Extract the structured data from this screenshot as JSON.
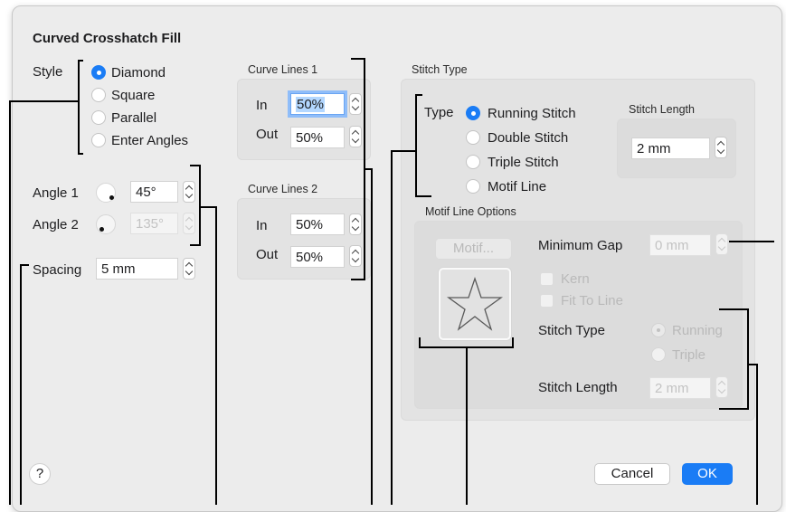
{
  "dialog": {
    "title": "Curved Crosshatch Fill",
    "style": {
      "label": "Style",
      "options": [
        "Diamond",
        "Square",
        "Parallel",
        "Enter Angles"
      ],
      "selected": "Diamond"
    },
    "angles": {
      "angle1_label": "Angle 1",
      "angle1_value": "45°",
      "angle2_label": "Angle 2",
      "angle2_value": "135°"
    },
    "spacing": {
      "label": "Spacing",
      "value": "5 mm"
    },
    "curve_lines_1": {
      "title": "Curve Lines 1",
      "in_label": "In",
      "in_value": "50%",
      "out_label": "Out",
      "out_value": "50%"
    },
    "curve_lines_2": {
      "title": "Curve Lines 2",
      "in_label": "In",
      "in_value": "50%",
      "out_label": "Out",
      "out_value": "50%"
    },
    "stitch_type": {
      "title": "Stitch Type",
      "type_label": "Type",
      "options": [
        "Running Stitch",
        "Double Stitch",
        "Triple Stitch",
        "Motif Line"
      ],
      "selected": "Running Stitch",
      "stitch_length_label": "Stitch Length",
      "stitch_length_value": "2 mm"
    },
    "motif_line_options": {
      "title": "Motif Line Options",
      "motif_button": "Motif...",
      "min_gap_label": "Minimum Gap",
      "min_gap_value": "0 mm",
      "kern_label": "Kern",
      "fit_to_line_label": "Fit To Line",
      "stitch_type_label": "Stitch Type",
      "stitch_type_options": [
        "Running",
        "Triple"
      ],
      "stitch_type_selected": "Running",
      "stitch_length_label": "Stitch Length",
      "stitch_length_value": "2 mm",
      "preview_icon": "star-outline-icon"
    },
    "buttons": {
      "help": "?",
      "cancel": "Cancel",
      "ok": "OK"
    }
  },
  "colors": {
    "accent": "#1a7cf5",
    "dialog_bg": "#ececec",
    "group_bg": "#e3e3e3"
  }
}
